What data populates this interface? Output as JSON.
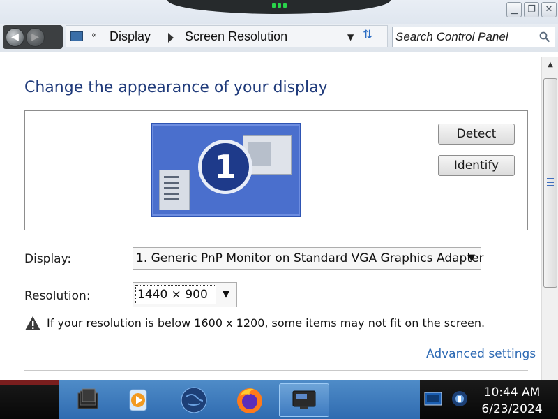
{
  "window": {
    "caption_buttons": [
      "minimize",
      "restore",
      "close"
    ]
  },
  "address_bar": {
    "overflow_chevron": "«",
    "breadcrumbs": [
      "Display",
      "Screen Resolution"
    ],
    "search_placeholder": "Search Control Panel"
  },
  "page": {
    "title": "Change the appearance of your display",
    "monitor_number": "1",
    "detect_label": "Detect",
    "identify_label": "Identify",
    "display_label": "Display:",
    "display_value": "1. Generic PnP Monitor on Standard VGA Graphics Adapter",
    "resolution_label": "Resolution:",
    "resolution_value": "1440 × 900",
    "warning_text": "If your resolution is below 1600 x 1200, some items may not fit on the screen.",
    "advanced_link": "Advanced settings"
  },
  "taskbar": {
    "apps": [
      "file-explorer-icon",
      "media-player-icon",
      "globe-browser-icon",
      "firefox-icon",
      "display-settings-icon"
    ],
    "active_app": "display-settings-icon",
    "tray": [
      "monitor-tray-icon",
      "network-tray-icon"
    ],
    "time": "10:44 AM",
    "date": "6/23/2024"
  },
  "colors": {
    "title_blue": "#1f3a7a",
    "link_blue": "#2d6ab4",
    "monitor_blue": "#4a6fcd",
    "taskbar_blue": "#2f6bb0"
  }
}
